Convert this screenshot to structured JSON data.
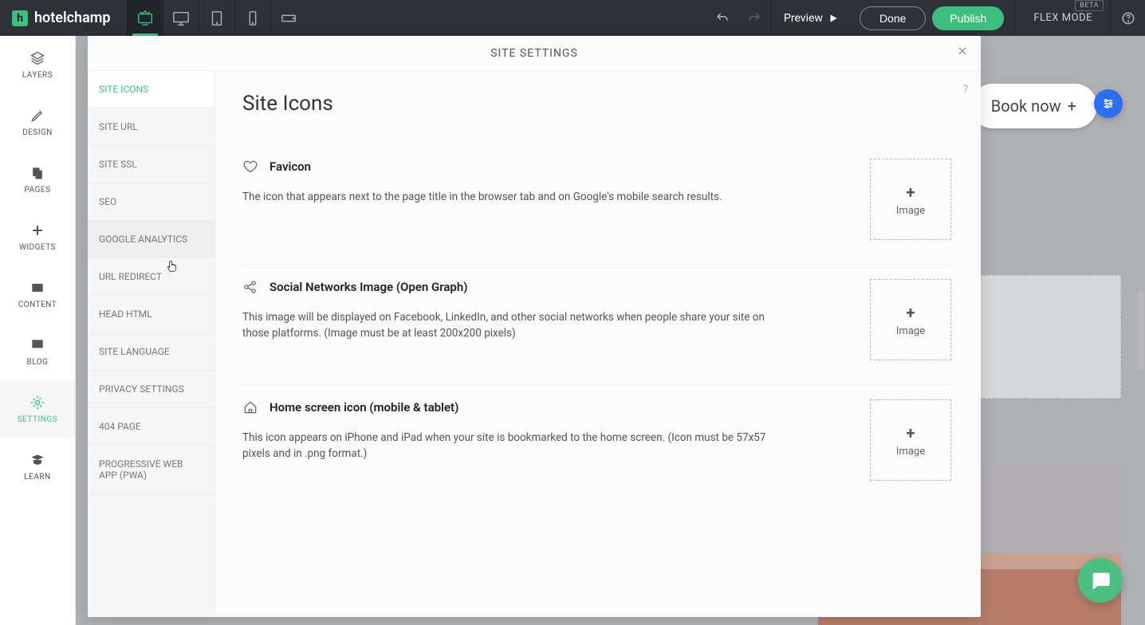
{
  "brand": {
    "logo_letter": "h",
    "name": "hotelchamp"
  },
  "topbar": {
    "preview": "Preview",
    "done": "Done",
    "publish": "Publish",
    "flexmode": "FLEX MODE",
    "beta": "BETA"
  },
  "leftnav": {
    "items": [
      {
        "label": "LAYERS"
      },
      {
        "label": "DESIGN"
      },
      {
        "label": "PAGES"
      },
      {
        "label": "WIDGETS"
      },
      {
        "label": "CONTENT"
      },
      {
        "label": "BLOG"
      },
      {
        "label": "SETTINGS"
      },
      {
        "label": "LEARN"
      }
    ]
  },
  "modal": {
    "title": "SITE SETTINGS",
    "help": "?",
    "nav": [
      "SITE ICONS",
      "SITE URL",
      "SITE SSL",
      "SEO",
      "GOOGLE ANALYTICS",
      "URL REDIRECT",
      "HEAD HTML",
      "SITE LANGUAGE",
      "PRIVACY SETTINGS",
      "404 PAGE",
      "PROGRESSIVE WEB APP (PWA)"
    ],
    "content": {
      "title": "Site Icons",
      "sections": [
        {
          "title": "Favicon",
          "desc": "The icon that appears next to the page title in the browser tab and on Google's mobile search results.",
          "drop_plus": "+",
          "drop_label": "Image"
        },
        {
          "title": "Social Networks Image (Open Graph)",
          "desc": "This image will be displayed on Facebook, LinkedIn, and other social networks when people share your site on those platforms. (Image must be at least 200x200 pixels)",
          "drop_plus": "+",
          "drop_label": "Image"
        },
        {
          "title": "Home screen icon (mobile & tablet)",
          "desc": "This icon appears on iPhone and iPad when your site is bookmarked to the home screen. (Icon must be 57x57 pixels and in .png format.)",
          "drop_plus": "+",
          "drop_label": "Image"
        }
      ]
    }
  },
  "canvas": {
    "booknow": "Book now",
    "booknow_plus": "+"
  }
}
